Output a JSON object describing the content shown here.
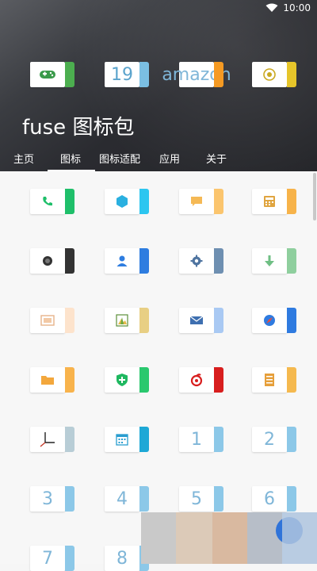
{
  "status": {
    "time": "10:00"
  },
  "app_title": "fuse 图标包",
  "header_icons": [
    {
      "name": "gamepad-icon",
      "tab_color": "#4cae4f",
      "text": ""
    },
    {
      "name": "calendar-19-icon",
      "tab_color": "#7bbfe3",
      "text": "19"
    },
    {
      "name": "amazon-icon",
      "tab_color": "#f59a23",
      "text": "amazon"
    },
    {
      "name": "currency-icon",
      "tab_color": "#e6c52a",
      "text": ""
    }
  ],
  "tabs": [
    {
      "label": "主页"
    },
    {
      "label": "图标"
    },
    {
      "label": "图标适配"
    },
    {
      "label": "应用"
    },
    {
      "label": "关于"
    }
  ],
  "active_tab": 1,
  "icons": [
    {
      "name": "phone-icon",
      "tab_color": "#1fbf6a",
      "text": ""
    },
    {
      "name": "hexagon-icon",
      "tab_color": "#2cc6f0",
      "text": ""
    },
    {
      "name": "chat-icon",
      "tab_color": "#fbc56e",
      "text": ""
    },
    {
      "name": "calculator-icon",
      "tab_color": "#f7b34a",
      "text": ""
    },
    {
      "name": "camera-icon",
      "tab_color": "#333333",
      "text": ""
    },
    {
      "name": "contacts-icon",
      "tab_color": "#2e7de0",
      "text": ""
    },
    {
      "name": "settings-gear-icon",
      "tab_color": "#6e8fb1",
      "text": ""
    },
    {
      "name": "download-icon",
      "tab_color": "#8fcf9e",
      "text": ""
    },
    {
      "name": "sim-card-icon",
      "tab_color": "#fde3cc",
      "text": ""
    },
    {
      "name": "gallery-icon",
      "tab_color": "#e8cf84",
      "text": ""
    },
    {
      "name": "mail-icon",
      "tab_color": "#a9c9f3",
      "text": ""
    },
    {
      "name": "browser-icon",
      "tab_color": "#2f7be0",
      "text": ""
    },
    {
      "name": "folder-icon",
      "tab_color": "#f8b34c",
      "text": ""
    },
    {
      "name": "shield-plus-icon",
      "tab_color": "#2ac86e",
      "text": ""
    },
    {
      "name": "netease-music-icon",
      "tab_color": "#d81e1e",
      "text": ""
    },
    {
      "name": "notebook-icon",
      "tab_color": "#f5b94f",
      "text": ""
    },
    {
      "name": "clock-icon",
      "tab_color": "#b8cdd6",
      "text": ""
    },
    {
      "name": "calendar-icon",
      "tab_color": "#1ea8d6",
      "text": ""
    },
    {
      "name": "number-1-icon",
      "tab_color": "#8cc8e8",
      "text": "1"
    },
    {
      "name": "number-2-icon",
      "tab_color": "#8cc8e8",
      "text": "2"
    },
    {
      "name": "number-3-icon",
      "tab_color": "#8cc8e8",
      "text": "3"
    },
    {
      "name": "number-4-icon",
      "tab_color": "#8cc8e8",
      "text": "4"
    },
    {
      "name": "number-5-icon",
      "tab_color": "#8cc8e8",
      "text": "5"
    },
    {
      "name": "number-6-icon",
      "tab_color": "#8cc8e8",
      "text": "6"
    },
    {
      "name": "number-7-icon",
      "tab_color": "#8cc8e8",
      "text": "7"
    },
    {
      "name": "number-8-icon",
      "tab_color": "#8cc8e8",
      "text": "8"
    }
  ]
}
